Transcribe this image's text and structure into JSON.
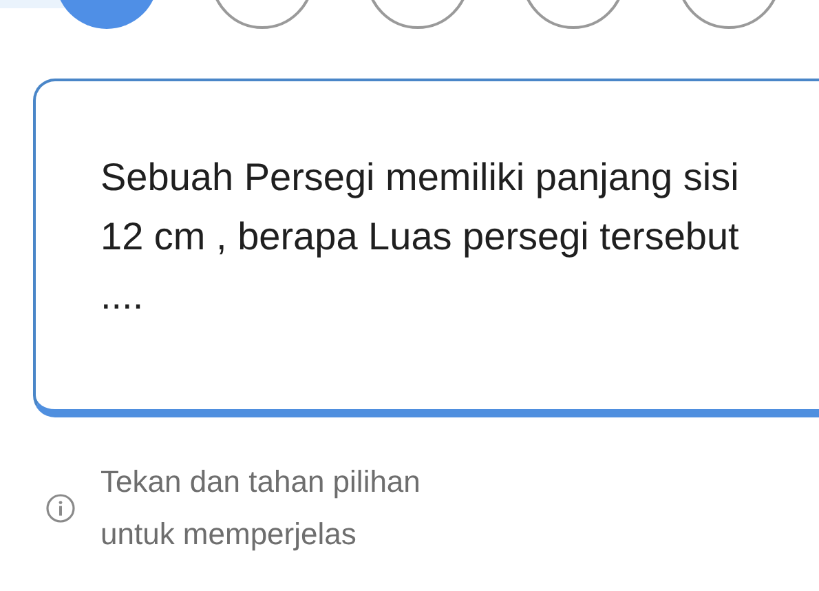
{
  "steps": [
    {
      "selected": true
    },
    {
      "selected": false
    },
    {
      "selected": false
    },
    {
      "selected": false
    },
    {
      "selected": false
    }
  ],
  "question": "Sebuah Persegi memiliki panjang sisi 12 cm , berapa Luas persegi tersebut ....",
  "hint": "Tekan dan tahan pilihan untuk memperjelas"
}
